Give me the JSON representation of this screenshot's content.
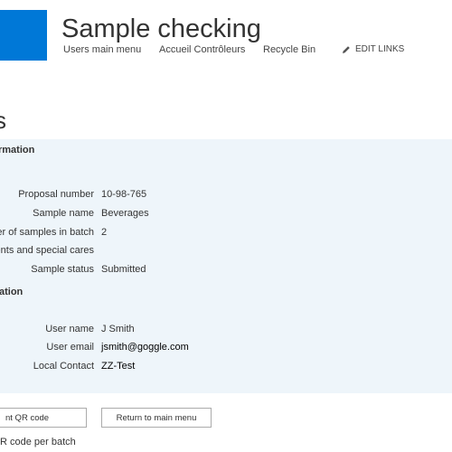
{
  "header": {
    "site_title": "Sample checking",
    "nav": [
      "Users main menu",
      "Accueil Contrôleurs",
      "Recycle Bin"
    ],
    "edit_links": "EDIT LINKS"
  },
  "page_title": "s",
  "sections": {
    "sample_info": {
      "heading": "rmation",
      "fields": [
        {
          "label": "Proposal number",
          "value": "10-98-765"
        },
        {
          "label": "Sample name",
          "value": "Beverages"
        },
        {
          "label": "ber of samples in batch",
          "value": "2"
        },
        {
          "label": "ments and special cares",
          "value": ""
        },
        {
          "label": "Sample status",
          "value": "Submitted"
        }
      ]
    },
    "user_info": {
      "heading": "ation",
      "fields": [
        {
          "label": "User name",
          "value": "J Smith"
        },
        {
          "label": "User email",
          "value": "jsmith@goggle.com"
        },
        {
          "label": "Local Contact",
          "value": "ZZ-Test"
        }
      ]
    }
  },
  "buttons": {
    "print_qr": "nt QR code",
    "return_main": "Return to main menu"
  },
  "footer_text": "R code per batch",
  "colors": {
    "brand": "#0078d7",
    "panel_bg": "#eef5fa"
  }
}
